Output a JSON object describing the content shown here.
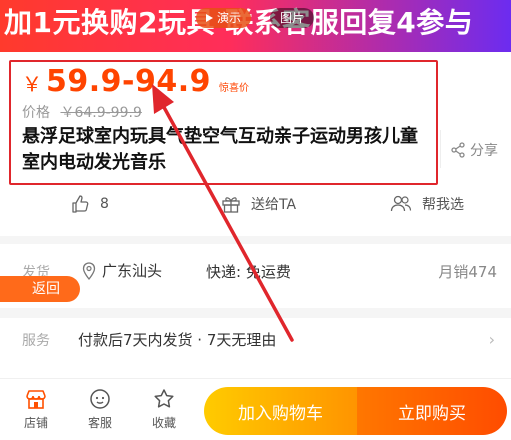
{
  "banner": {
    "text": "加1元换购2玩具  联系客服回复4参与",
    "demo_label": "演示",
    "pic_label": "图片"
  },
  "price": {
    "currency": "￥",
    "value": "59.9-94.9",
    "tag": "惊喜价",
    "orig_label": "价格",
    "orig_value": "￥64.9-99.9"
  },
  "product": {
    "title": "悬浮足球室内玩具气垫空气互动亲子运动男孩儿童室内电动发光音乐",
    "share_label": "分享"
  },
  "actions": {
    "like_count": "8",
    "gift_label": "送给TA",
    "help_label": "帮我选"
  },
  "shipping": {
    "label": "发货",
    "location": "广东汕头",
    "express": "快递: 免运费",
    "sales": "月销474"
  },
  "back_label": "返回",
  "service": {
    "label": "服务",
    "text": "付款后7天内发货 · 7天无理由"
  },
  "bottom": {
    "shop": "店铺",
    "service": "客服",
    "fav": "收藏",
    "cart": "加入购物车",
    "buy": "立即购买"
  },
  "colors": {
    "price": "#ff4400",
    "annotation": "#e0262c",
    "cart": "#ffa200",
    "buy": "#ff5a00"
  }
}
